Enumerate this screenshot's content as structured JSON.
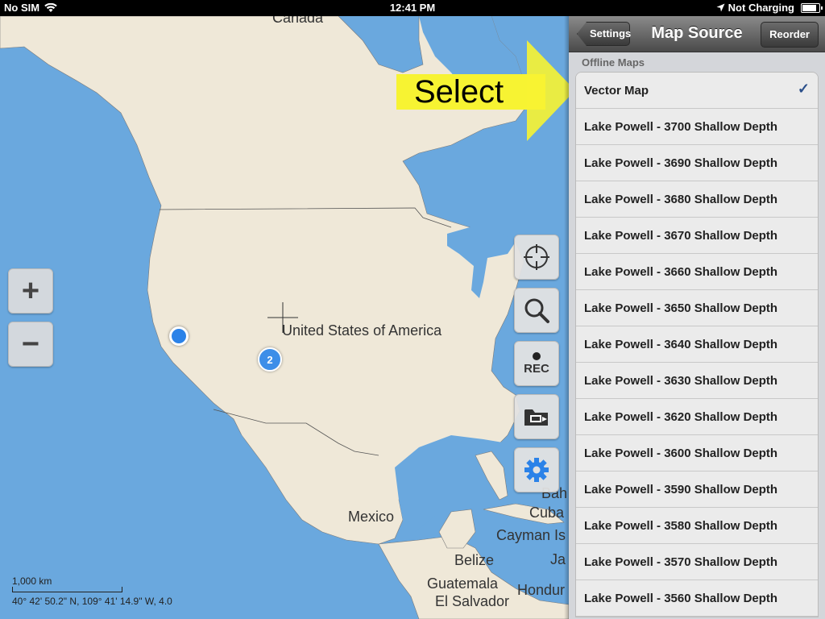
{
  "status_bar": {
    "carrier": "No SIM",
    "time": "12:41 PM",
    "charging": "Not Charging",
    "battery_level": 0.85
  },
  "map": {
    "labels": {
      "canada": "Canada",
      "usa": "United States of America",
      "mexico": "Mexico",
      "bahamas": "Bah",
      "cuba": "Cuba",
      "cayman": "Cayman Is",
      "belize": "Belize",
      "jamaica": "Ja",
      "guatemala": "Guatemala",
      "honduras": "Hondur",
      "el_salvador": "El Salvador"
    },
    "zoom_in_label": "+",
    "zoom_out_label": "−",
    "cluster_count": "2",
    "scale_label": "1,000 km",
    "coordinates": "40° 42' 50.2\" N, 109° 41' 14.9\" W, 4.0",
    "rec_label": "REC",
    "annotation": "Select"
  },
  "panel": {
    "back_label": "Settings",
    "title": "Map Source",
    "reorder_label": "Reorder",
    "section_header": "Offline Maps",
    "items": [
      {
        "label": "Vector Map",
        "checked": "✓"
      },
      {
        "label": "Lake Powell - 3700 Shallow Depth"
      },
      {
        "label": "Lake Powell - 3690 Shallow Depth"
      },
      {
        "label": "Lake Powell - 3680 Shallow Depth"
      },
      {
        "label": "Lake Powell - 3670 Shallow Depth"
      },
      {
        "label": "Lake Powell - 3660 Shallow Depth"
      },
      {
        "label": "Lake Powell - 3650 Shallow Depth"
      },
      {
        "label": "Lake Powell - 3640 Shallow Depth"
      },
      {
        "label": "Lake Powell - 3630 Shallow Depth"
      },
      {
        "label": "Lake Powell - 3620 Shallow Depth"
      },
      {
        "label": "Lake Powell - 3600 Shallow Depth"
      },
      {
        "label": "Lake Powell - 3590 Shallow Depth"
      },
      {
        "label": "Lake Powell - 3580 Shallow Depth"
      },
      {
        "label": "Lake Powell - 3570 Shallow Depth"
      },
      {
        "label": "Lake Powell - 3560 Shallow Depth"
      }
    ]
  },
  "colors": {
    "water": "#6aa8de",
    "land": "#efe8d8",
    "accent": "#2b82e8",
    "highlight": "#f7f332"
  }
}
